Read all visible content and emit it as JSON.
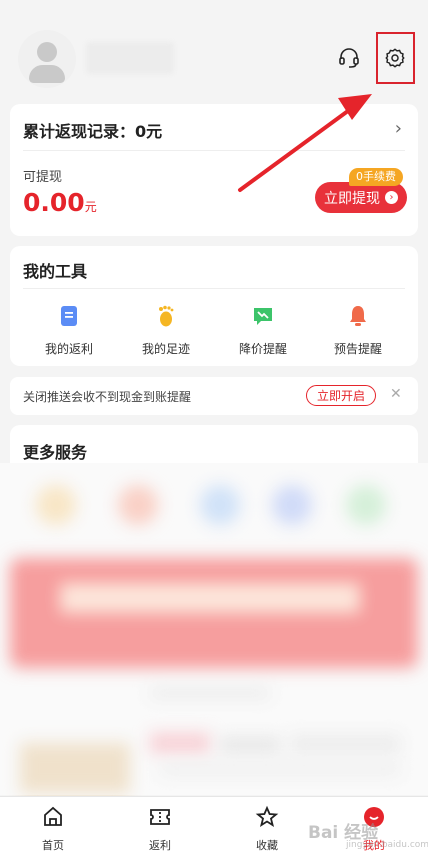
{
  "header": {
    "avatar_icon": "user-avatar-icon",
    "support_icon": "headset-icon",
    "settings_icon": "gear-icon"
  },
  "rebate": {
    "title": "累计返现记录：0元",
    "withdraw_label": "可提现",
    "amount": "0.00",
    "unit": "元",
    "fee_tag": "0手续费",
    "withdraw_button": "立即提现"
  },
  "tools": {
    "title": "我的工具",
    "items": [
      {
        "label": "我的返利",
        "icon": "rebate-doc-icon",
        "color": "#5b8cf5"
      },
      {
        "label": "我的足迹",
        "icon": "footprint-icon",
        "color": "#f5b623"
      },
      {
        "label": "降价提醒",
        "icon": "price-drop-icon",
        "color": "#3cc46a"
      },
      {
        "label": "预告提醒",
        "icon": "bell-icon",
        "color": "#f06a4a"
      }
    ]
  },
  "notice": {
    "text": "关闭推送会收不到现金到账提醒",
    "button": "立即开启",
    "close_icon": "close-icon"
  },
  "more": {
    "title": "更多服务"
  },
  "bottom_nav": {
    "items": [
      {
        "label": "首页",
        "icon": "home-icon"
      },
      {
        "label": "返利",
        "icon": "ticket-icon"
      },
      {
        "label": "收藏",
        "icon": "star-icon"
      },
      {
        "label": "我的",
        "icon": "smile-icon",
        "active": true
      }
    ]
  },
  "watermark": {
    "text": "Bai 经验",
    "sub": "jingyan.baidu.com"
  },
  "colors": {
    "accent": "#e5242b",
    "annotation": "#d9232d"
  }
}
